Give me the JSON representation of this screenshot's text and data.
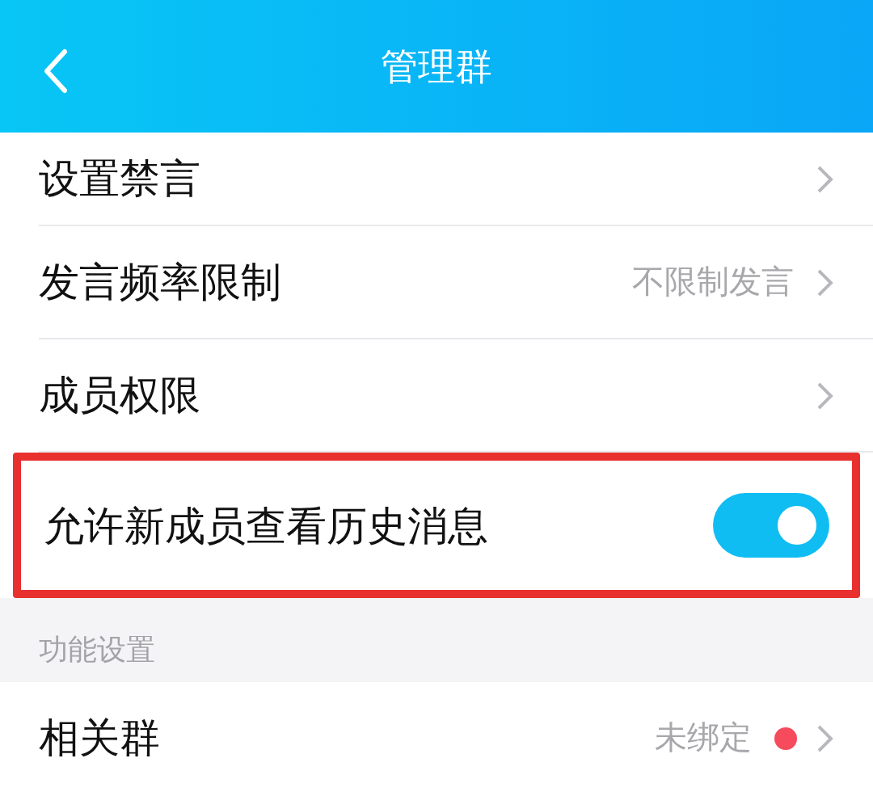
{
  "header": {
    "title": "管理群"
  },
  "items": [
    {
      "kind": "chevron",
      "label": "设置禁言"
    },
    {
      "kind": "chevron",
      "label": "发言频率限制",
      "value": "不限制发言"
    },
    {
      "kind": "chevron",
      "label": "成员权限"
    },
    {
      "kind": "toggle",
      "label": "允许新成员查看历史消息",
      "on": true,
      "highlighted": true
    }
  ],
  "section": {
    "title": "功能设置"
  },
  "items2": [
    {
      "kind": "chevron",
      "label": "相关群",
      "value": "未绑定",
      "badge": true
    }
  ]
}
